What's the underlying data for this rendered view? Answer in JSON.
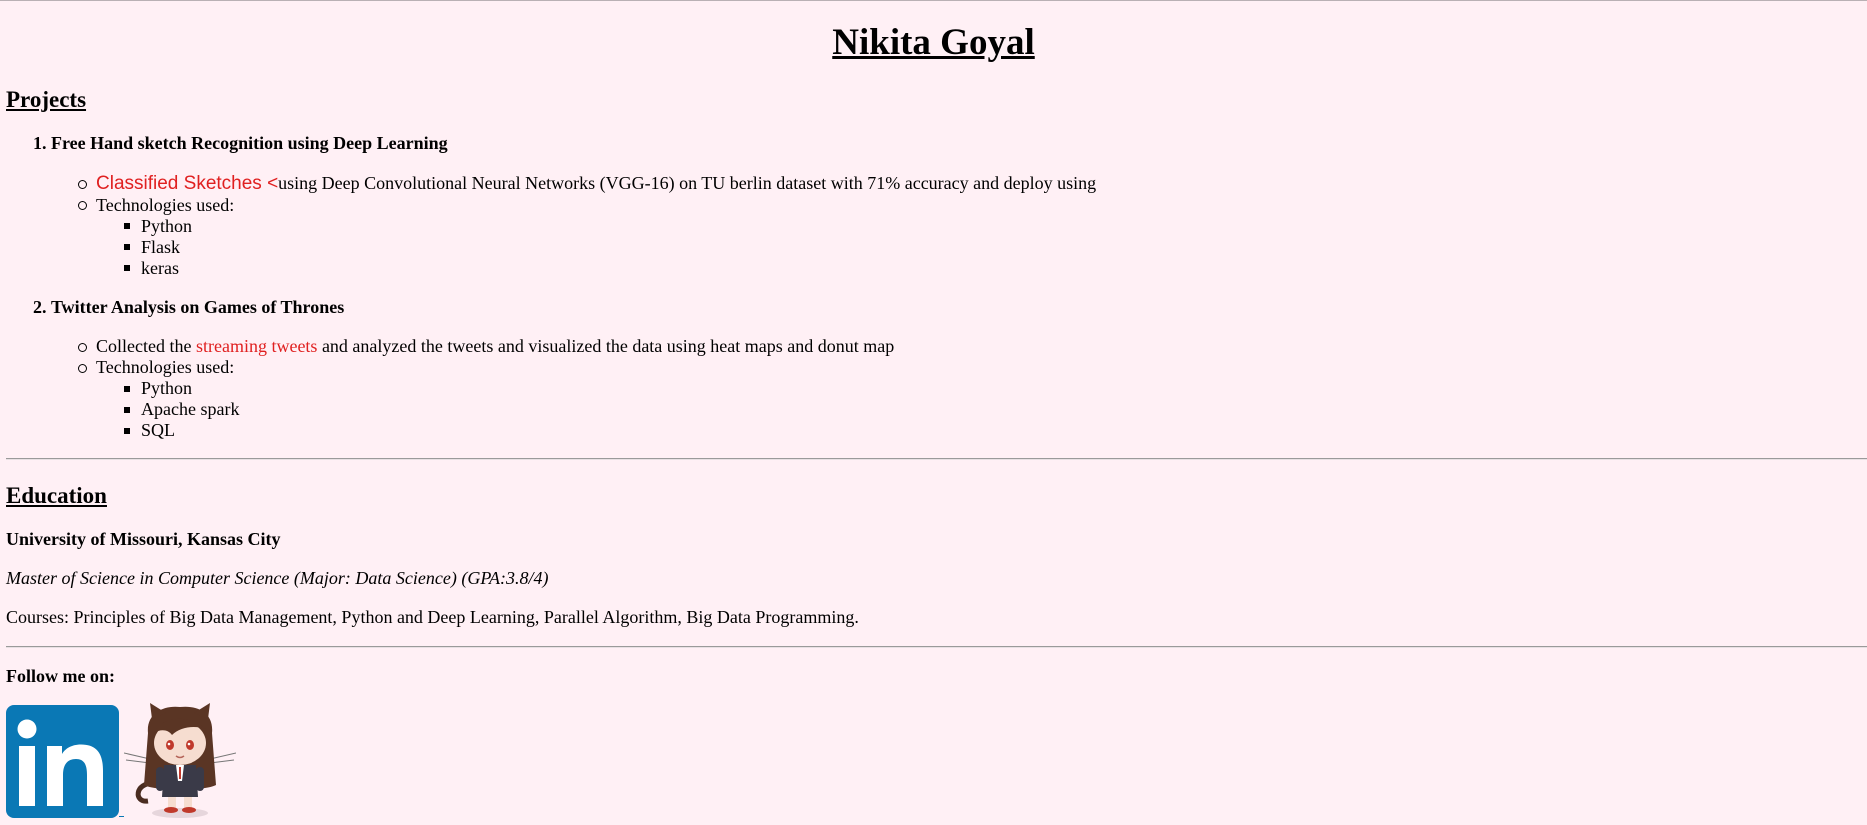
{
  "name": "Nikita Goyal",
  "projects": {
    "heading": "Projects",
    "items": [
      {
        "number": "1.",
        "title": "Free Hand sketch Recognition using Deep Learning",
        "desc_link": "Classified Sketches <",
        "desc_rest": "using Deep Convolutional Neural Networks (VGG-16) on TU berlin dataset with 71% accuracy and deploy using",
        "tech_label": "Technologies used:",
        "tech": [
          "Python",
          "Flask",
          "keras"
        ]
      },
      {
        "number": "2.",
        "title": "Twitter Analysis on Games of Thrones",
        "desc_prefix": "Collected the ",
        "desc_link": "streaming tweets",
        "desc_rest": " and analyzed the tweets and visualized the data using heat maps and donut map",
        "tech_label": "Technologies used:",
        "tech": [
          "Python",
          "Apache spark",
          "SQL"
        ]
      }
    ]
  },
  "education": {
    "heading": "Education",
    "school": "University of Missouri, Kansas City",
    "degree": "Master of Science in Computer Science (Major: Data Science) (GPA:3.8/4)",
    "courses": "Courses: Principles of Big Data Management, Python and Deep Learning, Parallel Algorithm, Big Data Programming."
  },
  "follow": {
    "label": "Follow me on:",
    "icons": [
      "linkedin-icon",
      "github-octocat-icon"
    ]
  },
  "colors": {
    "background": "#fff0f5",
    "link": "#e02020",
    "linkedin": "#0a78b5"
  }
}
